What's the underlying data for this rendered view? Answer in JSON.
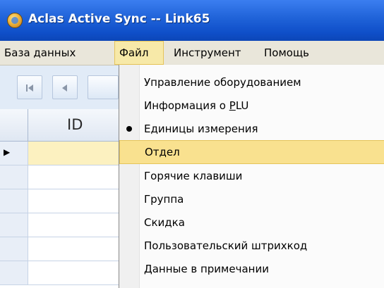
{
  "window": {
    "title": "Aclas Active Sync -- Link65",
    "app_icon": "aclas-app-icon"
  },
  "menubar": {
    "items": [
      {
        "label": "База данных"
      },
      {
        "label": "Файл",
        "active": true
      },
      {
        "label": "Инструмент"
      },
      {
        "label": "Помощь"
      }
    ]
  },
  "toolbar": {
    "first_icon": "first-record-icon",
    "prev_icon": "previous-record-icon"
  },
  "grid": {
    "columns": [
      {
        "label": "ID"
      }
    ],
    "current_row_indicator": "▶"
  },
  "file_menu": {
    "items": [
      {
        "label": "Управление оборудованием"
      },
      {
        "label_prefix": "Информация о ",
        "label_mnemonic": "P",
        "label_suffix": "LU"
      },
      {
        "label": "Единицы измерения",
        "checked": true
      },
      {
        "label": "Отдел",
        "highlighted": true
      },
      {
        "label": "Горячие клавиши"
      },
      {
        "label": "Группа"
      },
      {
        "label": "Скидка"
      },
      {
        "label": "Пользовательский штрихкод"
      },
      {
        "label": "Данные в примечании"
      }
    ]
  },
  "colors": {
    "titlebar": "#1f62d8",
    "menubar": "#e9e6da",
    "highlight": "#f9e18f",
    "toolbar": "#e1ebf7"
  }
}
